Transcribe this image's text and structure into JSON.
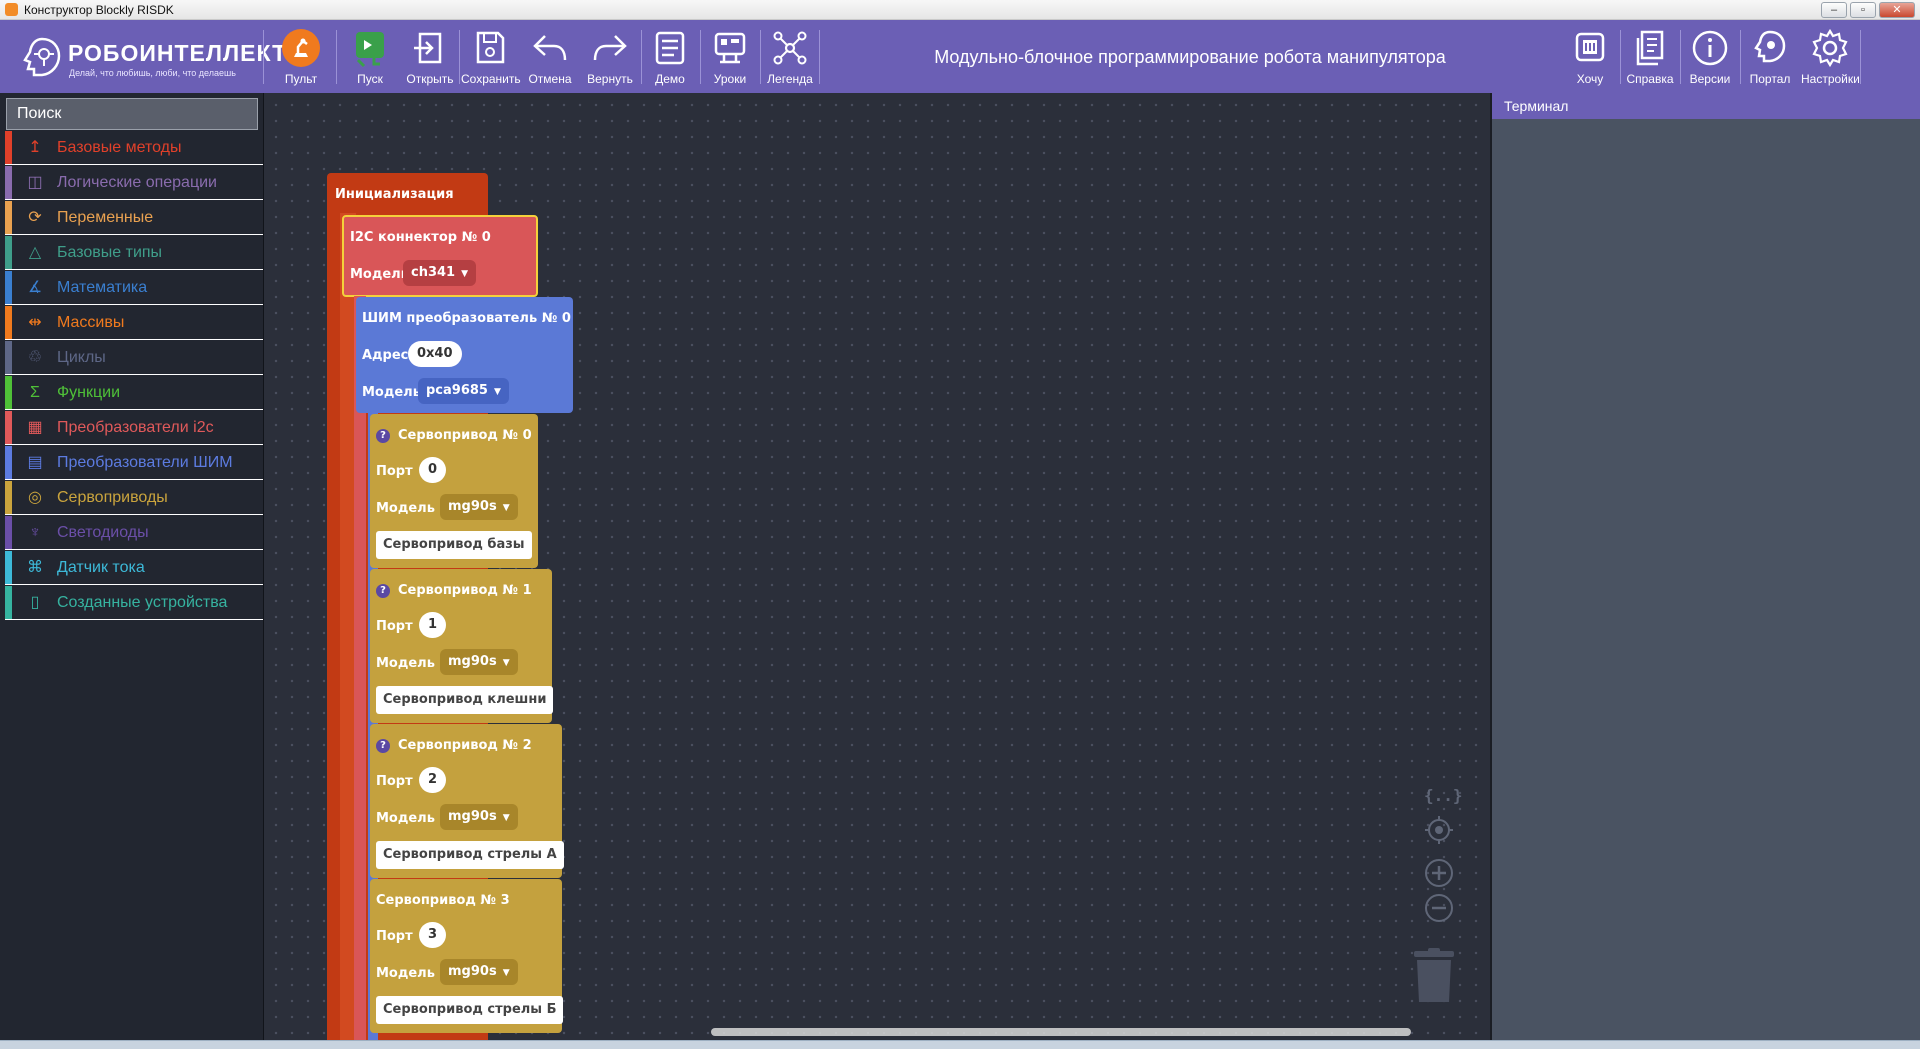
{
  "window": {
    "title": "Конструктор Blockly RISDK"
  },
  "logo": {
    "brand": "РОБОИНТЕЛЛЕКТ",
    "tagline": "Делай, что любишь, люби, что делаешь"
  },
  "toolbar": {
    "left_buttons": [
      {
        "label": "Пульт",
        "icon": "remote-icon"
      },
      {
        "label": "Пуск",
        "icon": "play-icon"
      },
      {
        "label": "Открыть",
        "icon": "open-icon"
      },
      {
        "label": "Сохранить",
        "icon": "save-icon"
      },
      {
        "label": "Отмена",
        "icon": "undo-icon"
      },
      {
        "label": "Вернуть",
        "icon": "redo-icon"
      },
      {
        "label": "Демо",
        "icon": "demo-icon"
      },
      {
        "label": "Уроки",
        "icon": "lessons-icon"
      },
      {
        "label": "Легенда",
        "icon": "legend-icon"
      }
    ],
    "title": "Модульно-блочное программирование робота манипулятора",
    "right_buttons": [
      {
        "label": "Хочу",
        "icon": "want-icon"
      },
      {
        "label": "Справка",
        "icon": "help-doc-icon"
      },
      {
        "label": "Версии",
        "icon": "info-icon"
      },
      {
        "label": "Портал",
        "icon": "portal-icon"
      },
      {
        "label": "Настройки",
        "icon": "gear-icon"
      }
    ]
  },
  "sidebar": {
    "search_placeholder": "Поиск",
    "categories": [
      {
        "label": "Базовые методы",
        "color": "#e0402a"
      },
      {
        "label": "Логические операции",
        "color": "#8a6cae"
      },
      {
        "label": "Переменные",
        "color": "#e9a150"
      },
      {
        "label": "Базовые типы",
        "color": "#3f9e8a"
      },
      {
        "label": "Математика",
        "color": "#3a7fd0"
      },
      {
        "label": "Массивы",
        "color": "#f07a1e"
      },
      {
        "label": "Циклы",
        "color": "#5e6787"
      },
      {
        "label": "Функции",
        "color": "#4fc038"
      },
      {
        "label": "Преобразователи i2c",
        "color": "#e0595a"
      },
      {
        "label": "Преобразователи ШИМ",
        "color": "#5c7be0"
      },
      {
        "label": "Сервоприводы",
        "color": "#caa43d"
      },
      {
        "label": "Светодиоды",
        "color": "#6b4fa8"
      },
      {
        "label": "Датчик тока",
        "color": "#3db9d8"
      },
      {
        "label": "Созданные устройства",
        "color": "#36b3a0"
      }
    ]
  },
  "blocks": {
    "init": {
      "title": "Инициализация",
      "color": "#c23a14"
    },
    "i2c": {
      "title": "I2C коннектор №",
      "number": "0",
      "model_label": "Модель",
      "model": "ch341",
      "color": "#d95658"
    },
    "pwm": {
      "title": "ШИМ преобразователь №",
      "number": "0",
      "address_label": "Адрес",
      "address": "0x40",
      "model_label": "Модель",
      "model": "pca9685",
      "color": "#5b79d6"
    },
    "servos": [
      {
        "title": "Сервопривод №",
        "number": "0",
        "port_label": "Порт",
        "port": "0",
        "model_label": "Модель",
        "model": "mg90s",
        "name": "Сервопривод базы",
        "help": "?"
      },
      {
        "title": "Сервопривод №",
        "number": "1",
        "port_label": "Порт",
        "port": "1",
        "model_label": "Модель",
        "model": "mg90s",
        "name": "Сервопривод клешни",
        "help": "?"
      },
      {
        "title": "Сервопривод №",
        "number": "2",
        "port_label": "Порт",
        "port": "2",
        "model_label": "Модель",
        "model": "mg90s",
        "name": "Сервопривод стрелы А",
        "help": "?"
      },
      {
        "title": "Сервопривод №",
        "number": "3",
        "port_label": "Порт",
        "port": "3",
        "model_label": "Модель",
        "model": "mg90s",
        "name": "Сервопривод стрелы Б"
      }
    ],
    "servo_color": "#c4a13e"
  },
  "workspace_tools": {
    "code_icon_text": "{..}"
  },
  "terminal": {
    "title": "Терминал"
  }
}
